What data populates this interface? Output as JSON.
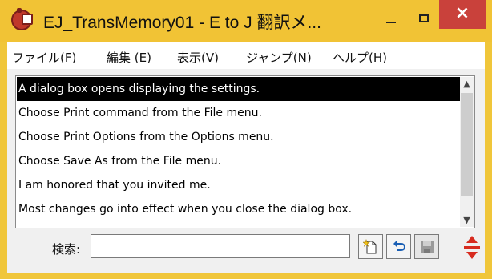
{
  "window": {
    "title": "EJ_TransMemory01 - E to J 翻訳メ...",
    "close_glyph": "×"
  },
  "menubar": [
    {
      "label": "ファイル(F)"
    },
    {
      "label": "編集 (E)"
    },
    {
      "label": "表示(V)"
    },
    {
      "label": "ジャンプ(N)"
    },
    {
      "label": "ヘルプ(H)"
    }
  ],
  "list": {
    "selected_index": 0,
    "items": [
      "A dialog box opens displaying the settings.",
      "Choose Print command from the File menu.",
      "Choose Print Options from the Options menu.",
      "Choose Save As from the File menu.",
      "I am honored that you invited me.",
      "Most changes go into effect when you close the dialog box."
    ],
    "scroll_up_glyph": "▲",
    "scroll_down_glyph": "▼"
  },
  "search": {
    "label": "検索:",
    "value": ""
  },
  "toolbar": [
    {
      "name": "new-entry-button",
      "icon": "new-document-icon"
    },
    {
      "name": "undo-button",
      "icon": "undo-icon"
    },
    {
      "name": "save-button",
      "icon": "floppy-disk-icon",
      "disabled": true
    }
  ],
  "colors": {
    "frame": "#f1c335",
    "close": "#c9413b",
    "selection": "#000000",
    "accent_red": "#d72b1f"
  }
}
